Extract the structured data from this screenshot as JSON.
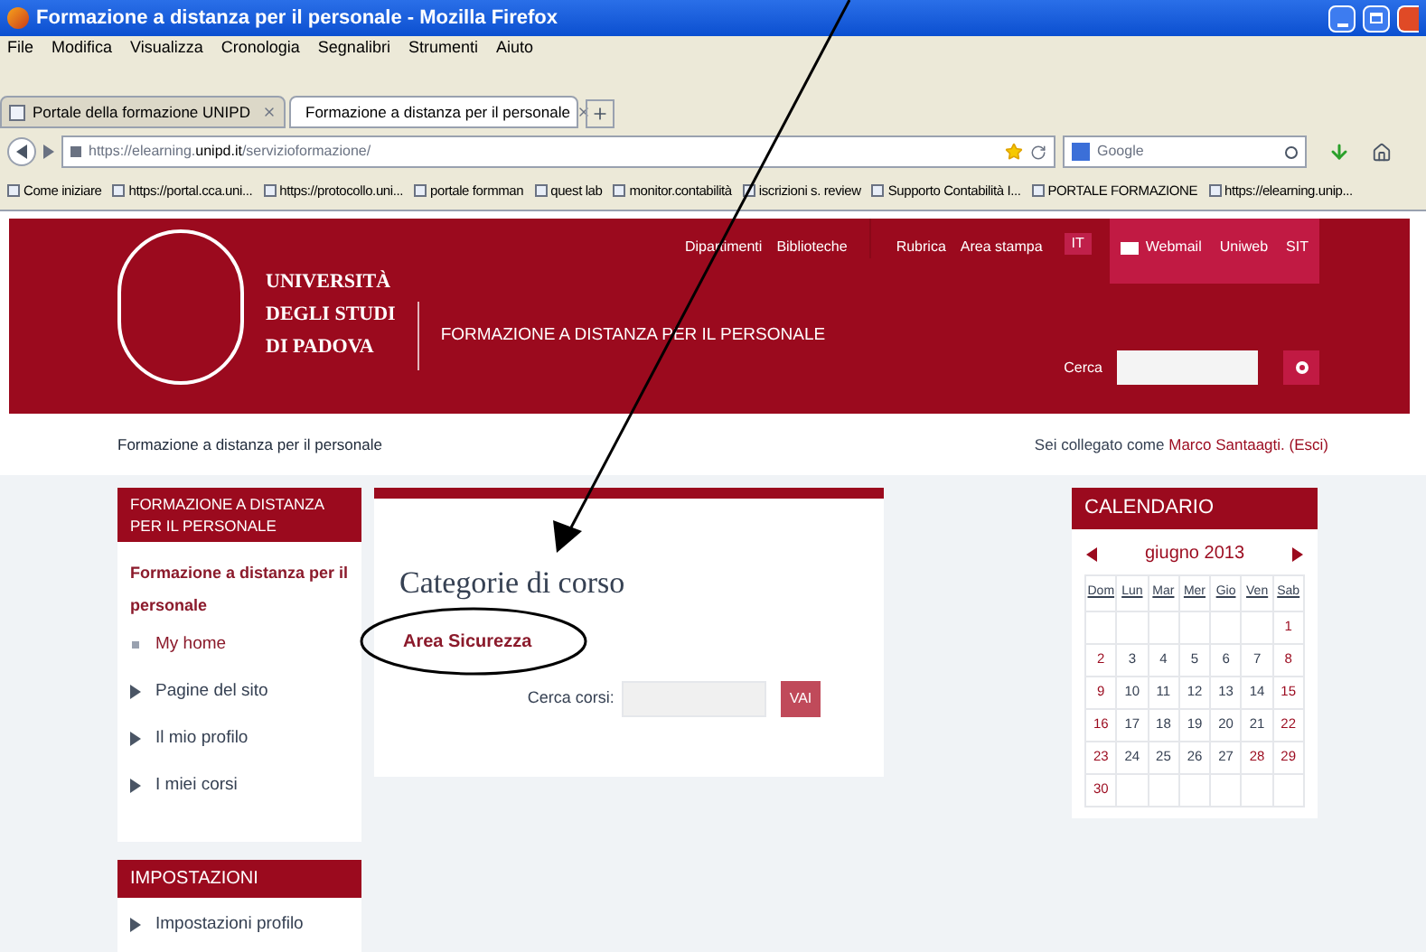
{
  "window": {
    "title": "Formazione a distanza per il personale - Mozilla Firefox"
  },
  "menu": [
    "File",
    "Modifica",
    "Visualizza",
    "Cronologia",
    "Segnalibri",
    "Strumenti",
    "Aiuto"
  ],
  "tabs": [
    {
      "label": "Portale della formazione UNIPD",
      "selected": false
    },
    {
      "label": "Formazione a distanza per il personale",
      "selected": true
    }
  ],
  "address": {
    "prefix": "https://elearning.",
    "domain": "unipd.it",
    "path": "/servizioformazione/"
  },
  "search": {
    "placeholder": "Google"
  },
  "bookmarks": [
    "Come iniziare",
    "https://portal.cca.uni...",
    "https://protocollo.uni...",
    "portale formman",
    "quest lab",
    "monitor.contabilità",
    "iscrizioni s. review",
    "Supporto Contabilità I...",
    "PORTALE FORMAZIONE",
    "https://elearning.unip..."
  ],
  "header": {
    "university": [
      "UNIVERSITÀ",
      "DEGLI STUDI",
      "DI PADOVA"
    ],
    "site_title": "FORMAZIONE A DISTANZA PER IL PERSONALE",
    "nav_links": [
      "Dipartimenti",
      "Biblioteche",
      "Rubrica",
      "Area stampa"
    ],
    "language": "IT",
    "service_links": [
      "Webmail",
      "Uniweb",
      "SIT"
    ],
    "search_label": "Cerca"
  },
  "breadcrumb": "Formazione a distanza per il personale",
  "login": {
    "prefix": "Sei collegato come",
    "user": "Marco Santaagti.",
    "logout": "(Esci)"
  },
  "sidebar": {
    "title": "FORMAZIONE A DISTANZA PER IL PERSONALE",
    "current": "Formazione a distanza per il personale",
    "items": [
      {
        "label": "My home",
        "kind": "leaf"
      },
      {
        "label": "Pagine del sito",
        "kind": "branch"
      },
      {
        "label": "Il mio profilo",
        "kind": "branch"
      },
      {
        "label": "I miei corsi",
        "kind": "branch"
      }
    ]
  },
  "settings": {
    "title": "IMPOSTAZIONI",
    "items": [
      {
        "label": "Impostazioni profilo",
        "kind": "branch"
      }
    ]
  },
  "main": {
    "heading": "Categorie di corso",
    "category": "Area Sicurezza",
    "search_label": "Cerca corsi:",
    "search_button": "VAI"
  },
  "calendar": {
    "title": "CALENDARIO",
    "month": "giugno 2013",
    "weekdays": [
      "Dom",
      "Lun",
      "Mar",
      "Mer",
      "Gio",
      "Ven",
      "Sab"
    ],
    "weeks": [
      [
        {
          "kind": "blank"
        },
        {
          "kind": "blank"
        },
        {
          "kind": "blank"
        },
        {
          "kind": "blank"
        },
        {
          "kind": "blank"
        },
        {
          "kind": "blank"
        },
        {
          "kind": "day",
          "day": "1",
          "highlighted": true
        }
      ],
      [
        {
          "kind": "day",
          "day": "2",
          "highlighted": true
        },
        {
          "kind": "day",
          "day": "3",
          "highlighted": false
        },
        {
          "kind": "day",
          "day": "4",
          "highlighted": false
        },
        {
          "kind": "day",
          "day": "5",
          "highlighted": false
        },
        {
          "kind": "day",
          "day": "6",
          "highlighted": false
        },
        {
          "kind": "day",
          "day": "7",
          "highlighted": false
        },
        {
          "kind": "day",
          "day": "8",
          "highlighted": true
        }
      ],
      [
        {
          "kind": "day",
          "day": "9",
          "highlighted": true
        },
        {
          "kind": "day",
          "day": "10",
          "highlighted": false
        },
        {
          "kind": "day",
          "day": "11",
          "highlighted": false
        },
        {
          "kind": "day",
          "day": "12",
          "highlighted": false
        },
        {
          "kind": "day",
          "day": "13",
          "highlighted": false
        },
        {
          "kind": "day",
          "day": "14",
          "highlighted": false
        },
        {
          "kind": "day",
          "day": "15",
          "highlighted": true
        }
      ],
      [
        {
          "kind": "day",
          "day": "16",
          "highlighted": true
        },
        {
          "kind": "day",
          "day": "17",
          "highlighted": false
        },
        {
          "kind": "day",
          "day": "18",
          "highlighted": false
        },
        {
          "kind": "day",
          "day": "19",
          "highlighted": false
        },
        {
          "kind": "day",
          "day": "20",
          "highlighted": false
        },
        {
          "kind": "day",
          "day": "21",
          "highlighted": false
        },
        {
          "kind": "day",
          "day": "22",
          "highlighted": true
        }
      ],
      [
        {
          "kind": "day",
          "day": "23",
          "highlighted": true
        },
        {
          "kind": "day",
          "day": "24",
          "highlighted": false
        },
        {
          "kind": "day",
          "day": "25",
          "highlighted": false
        },
        {
          "kind": "day",
          "day": "26",
          "highlighted": false
        },
        {
          "kind": "day",
          "day": "27",
          "highlighted": false
        },
        {
          "kind": "day",
          "day": "28",
          "highlighted": true
        },
        {
          "kind": "day",
          "day": "29",
          "highlighted": true
        }
      ],
      [
        {
          "kind": "day",
          "day": "30",
          "highlighted": true
        },
        {
          "kind": "blank"
        },
        {
          "kind": "blank"
        },
        {
          "kind": "blank"
        },
        {
          "kind": "blank"
        },
        {
          "kind": "blank"
        },
        {
          "kind": "blank"
        }
      ]
    ]
  }
}
